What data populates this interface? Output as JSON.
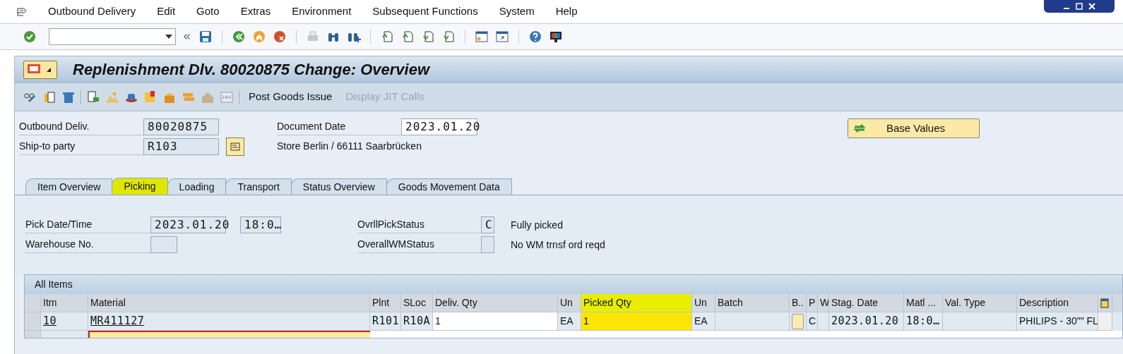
{
  "menu": [
    "Outbound Delivery",
    "Edit",
    "Goto",
    "Extras",
    "Environment",
    "Subsequent Functions",
    "System",
    "Help"
  ],
  "title": "Replenishment Dlv. 80020875 Change: Overview",
  "app_toolbar": [
    {
      "label": "Post Goods Issue",
      "disabled": false
    },
    {
      "label": "Display JIT Calls",
      "disabled": true
    }
  ],
  "header": {
    "outbound_deliv": {
      "label": "Outbound Deliv.",
      "value": "80020875"
    },
    "ship_to": {
      "label": "Ship-to party",
      "value": "R103"
    },
    "document_date": {
      "label": "Document Date",
      "value": "2023.01.20"
    },
    "party_name": "Store Berlin / 66111 Saarbrücken",
    "base_values_button": "Base Values"
  },
  "tabs": [
    {
      "label": "Item Overview",
      "selected": false,
      "highlighted": false
    },
    {
      "label": "Picking",
      "selected": true,
      "highlighted": true
    },
    {
      "label": "Loading",
      "selected": false,
      "highlighted": false
    },
    {
      "label": "Transport",
      "selected": false,
      "highlighted": false
    },
    {
      "label": "Status Overview",
      "selected": false,
      "highlighted": false
    },
    {
      "label": "Goods Movement Data",
      "selected": false,
      "highlighted": false
    }
  ],
  "picking": {
    "pick_date_time": {
      "label": "Pick Date/Time",
      "date": "2023.01.20",
      "time": "18:0…"
    },
    "warehouse_no": {
      "label": "Warehouse No."
    },
    "ovrl_pick_status": {
      "label": "OvrllPickStatus",
      "value": "C",
      "text": "Fully picked"
    },
    "overall_wm_status": {
      "label": "OverallWMStatus",
      "text": "No WM trnsf ord reqd"
    }
  },
  "table": {
    "title": "All Items",
    "columns": [
      {
        "label": "Itm",
        "highlighted": false
      },
      {
        "label": "Material",
        "highlighted": false
      },
      {
        "label": "Plnt",
        "highlighted": false
      },
      {
        "label": "SLoc",
        "highlighted": false
      },
      {
        "label": "Deliv. Qty",
        "highlighted": false
      },
      {
        "label": "Un",
        "highlighted": false
      },
      {
        "label": "Picked Qty",
        "highlighted": true
      },
      {
        "label": "Un",
        "highlighted": false
      },
      {
        "label": "Batch",
        "highlighted": false
      },
      {
        "label": "B..",
        "highlighted": false
      },
      {
        "label": "P",
        "highlighted": false
      },
      {
        "label": "W",
        "highlighted": false
      },
      {
        "label": "Stag. Date",
        "highlighted": false
      },
      {
        "label": "Matl ...",
        "highlighted": false
      },
      {
        "label": "Val. Type",
        "highlighted": false
      },
      {
        "label": "Description",
        "highlighted": false
      }
    ],
    "rows": [
      {
        "cells": [
          "10",
          "MR411127",
          "R101",
          "R10A",
          "1",
          "EA",
          "1",
          "EA",
          null,
          null,
          "C",
          null,
          "2023.01.20",
          "18:0…",
          null,
          "PHILIPS - 30\"\" FL"
        ]
      }
    ]
  }
}
